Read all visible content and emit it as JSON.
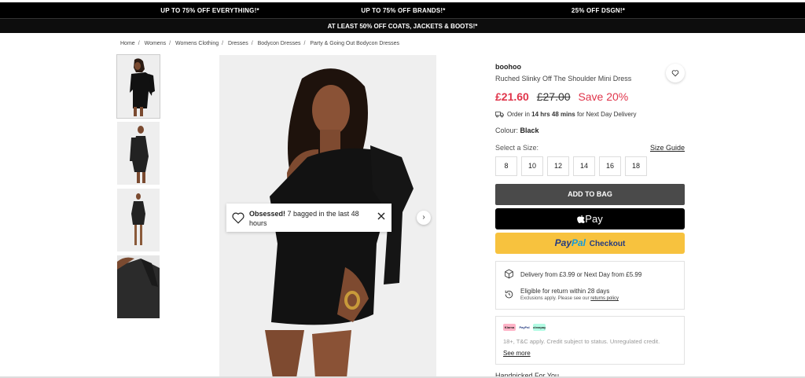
{
  "promos": {
    "top": [
      "UP TO 75% OFF EVERYTHING!*",
      "UP TO 75% OFF BRANDS!*",
      "25% OFF DSGN!*"
    ],
    "second": "AT LEAST 50% OFF COATS, JACKETS & BOOTS!*"
  },
  "breadcrumb": [
    "Home",
    "Womens",
    "Womens Clothing",
    "Dresses",
    "Bodycon Dresses",
    "Party & Going Out Bodycon Dresses"
  ],
  "gallery": {
    "thumbnail_count": 4,
    "next_icon": "chevron-right-icon"
  },
  "toast": {
    "bold": "Obsessed!",
    "text": " 7 bagged in the last 48 hours",
    "icon": "heart-icon",
    "close_icon": "close-icon"
  },
  "product": {
    "brand": "boohoo",
    "name": "Ruched Slinky Off The Shoulder Mini Dress",
    "price_now": "£21.60",
    "price_was": "£27.00",
    "save": "Save 20%",
    "order_prefix": "Order in ",
    "order_time": "14 hrs 48 mins",
    "order_suffix": " for Next Day Delivery",
    "colour_label": "Colour: ",
    "colour_value": "Black",
    "size_label": "Select a Size:",
    "size_guide": "Size Guide",
    "sizes": [
      "8",
      "10",
      "12",
      "14",
      "16",
      "18"
    ],
    "add_to_bag": "ADD TO BAG",
    "apple_pay": "Pay",
    "paypal_word1": "Pay",
    "paypal_word2": "Pal",
    "paypal_checkout": "Checkout"
  },
  "delivery_info": {
    "delivery": "Delivery from £3.99 or Next Day from £5.99",
    "returns": "Eligible for return within 28 days",
    "returns_note": "Exclusions apply. Please see our ",
    "returns_link": "returns policy"
  },
  "bnpl": {
    "logos": [
      "Klarna",
      "PayPal",
      "clearpay"
    ],
    "text": "18+, T&C apply. Credit subject to status. Unregulated credit.",
    "see_more": "See more"
  },
  "handpicked": "Handpicked For You",
  "colors": {
    "sale_red": "#e0354b",
    "bag_button": "#4a4a4a",
    "paypal_yellow": "#f7c23e",
    "promo_black": "#000000"
  }
}
